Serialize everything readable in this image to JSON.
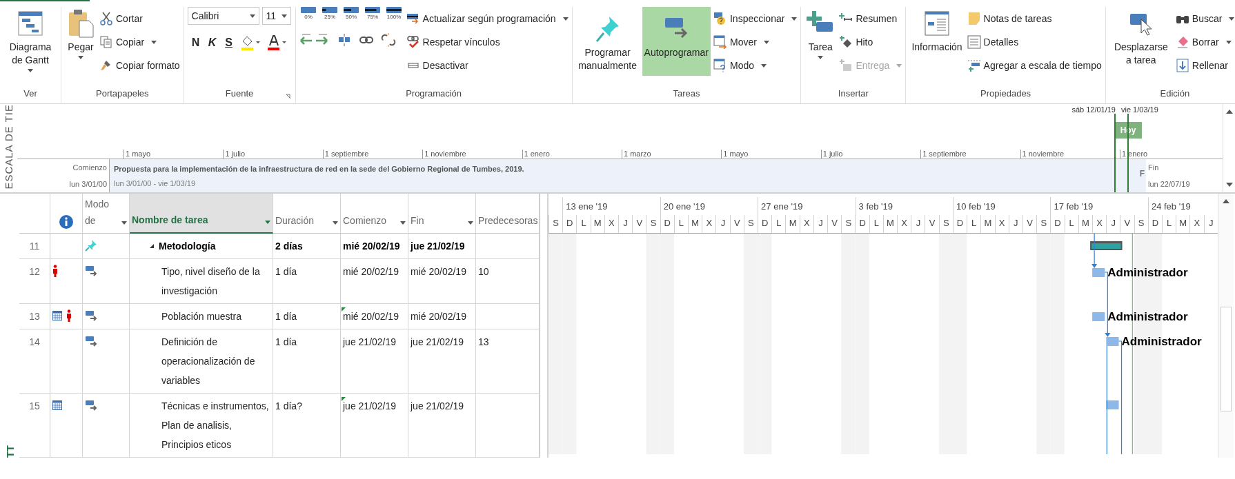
{
  "ribbon": {
    "view": {
      "label": "Ver",
      "gantt_chart": "Diagrama de Gantt"
    },
    "clipboard": {
      "label": "Portapapeles",
      "paste": "Pegar",
      "cut": "Cortar",
      "copy": "Copiar",
      "format_painter": "Copiar formato"
    },
    "font": {
      "label": "Fuente",
      "font_name": "Calibri",
      "font_size": "11",
      "bold": "N",
      "italic": "K",
      "underline": "S"
    },
    "schedule": {
      "label": "Programación",
      "percent_buttons": [
        "0%",
        "25%",
        "50%",
        "75%",
        "100%"
      ],
      "update_as_scheduled": "Actualizar según programación",
      "respect_links": "Respetar vínculos",
      "inactivate": "Desactivar"
    },
    "tasks": {
      "label": "Tareas",
      "manually_schedule": {
        "label": "Programar manualmente",
        "selected": false
      },
      "auto_schedule": {
        "label": "Autoprogramar",
        "selected": true
      },
      "inspect": "Inspeccionar",
      "move": "Mover",
      "mode": "Modo"
    },
    "insert": {
      "label": "Insertar",
      "task": "Tarea",
      "summary": "Resumen",
      "milestone": "Hito",
      "deliverable": {
        "label": "Entrega",
        "disabled": true
      }
    },
    "properties": {
      "label": "Propiedades",
      "information": "Información",
      "task_notes": "Notas de tareas",
      "details": "Detalles",
      "add_to_timeline": "Agregar a escala de tiempo"
    },
    "editing": {
      "label": "Edición",
      "scroll_to_task": "Desplazarse a tarea",
      "find": "Buscar",
      "clear": "Borrar",
      "fill": "Rellenar"
    }
  },
  "timeline": {
    "side_label": "ESCALA DE TIE",
    "view_start": "sáb 12/01/19",
    "view_end": "vie 1/03/19",
    "today": "Hoy",
    "months": [
      "1 mayo",
      "1 julio",
      "1 septiembre",
      "1 noviembre",
      "1 enero",
      "1 marzo",
      "1 mayo",
      "1 julio",
      "1 septiembre",
      "1 noviembre",
      "1 enero"
    ],
    "start_label": "Comienzo",
    "start_date": "lun 3/01/00",
    "finish_label": "Fin",
    "finish_date": "lun 22/07/19",
    "bar": {
      "title": "Propuesta para la implementación de la infraestructura de red en la sede del Gobierno Regional de Tumbes, 2019.",
      "dates": "lun 3/01/00 - vie 1/03/19",
      "end_text": "F"
    }
  },
  "sheet": {
    "side_label": "TT",
    "columns": [
      {
        "label": "Modo de",
        "filter": true,
        "selected": false
      },
      {
        "label": "Nombre de tarea",
        "filter": true,
        "selected": true
      },
      {
        "label": "Duración",
        "filter": true,
        "selected": false
      },
      {
        "label": "Comienzo",
        "filter": true,
        "selected": false
      },
      {
        "label": "Fin",
        "filter": true,
        "selected": false
      },
      {
        "label": "Predecesoras",
        "filter": false,
        "selected": false
      }
    ],
    "rows": [
      {
        "id": "11",
        "manually_scheduled": true,
        "calendar": false,
        "overallocated": false,
        "start_warning": false,
        "name": "Metodología",
        "expanded": true,
        "duration": "2 días",
        "start": "mié 20/02/19",
        "finish": "jue 21/02/19",
        "children": [
          {
            "id": "12",
            "manually_scheduled": false,
            "calendar": false,
            "overallocated": true,
            "start_warning": false,
            "name": "Tipo, nivel diseño de la investigación",
            "duration": "1 día",
            "start": "mié 20/02/19",
            "finish": "mié 20/02/19",
            "predecessors": "10",
            "resource": "Administrador"
          },
          {
            "id": "13",
            "manually_scheduled": false,
            "calendar": true,
            "overallocated": true,
            "start_warning": true,
            "name": "Población muestra",
            "duration": "1 día",
            "start": "mié 20/02/19",
            "finish": "mié 20/02/19",
            "resource": "Administrador"
          },
          {
            "id": "14",
            "manually_scheduled": false,
            "calendar": false,
            "overallocated": false,
            "start_warning": false,
            "name": "Definición de operacionalización de variables",
            "duration": "1 día",
            "start": "jue 21/02/19",
            "finish": "jue 21/02/19",
            "predecessors": "13",
            "resource": "Administrador"
          },
          {
            "id": "15",
            "manually_scheduled": false,
            "calendar": true,
            "overallocated": false,
            "start_warning": true,
            "name": "Técnicas e instrumentos, Plan de analisis, Principios eticos",
            "duration": "1 día?",
            "start": "jue 21/02/19",
            "finish": "jue 21/02/19"
          }
        ]
      }
    ]
  },
  "gantt": {
    "lead_days": [
      "S"
    ],
    "weeks": [
      {
        "label": "13 ene '19",
        "days": [
          "D",
          "L",
          "M",
          "X",
          "J",
          "V",
          "S"
        ]
      },
      {
        "label": "20 ene '19",
        "days": [
          "D",
          "L",
          "M",
          "X",
          "J",
          "V",
          "S"
        ]
      },
      {
        "label": "27 ene '19",
        "days": [
          "D",
          "L",
          "M",
          "X",
          "J",
          "V",
          "S"
        ]
      },
      {
        "label": "3 feb '19",
        "days": [
          "D",
          "L",
          "M",
          "X",
          "J",
          "V",
          "S"
        ]
      },
      {
        "label": "10 feb '19",
        "days": [
          "D",
          "L",
          "M",
          "X",
          "J",
          "V",
          "S"
        ]
      },
      {
        "label": "17 feb '19",
        "days": [
          "D",
          "L",
          "M",
          "X",
          "J",
          "V",
          "S"
        ]
      },
      {
        "label": "24 feb '19",
        "days": [
          "D",
          "L",
          "M",
          "X",
          "J"
        ]
      }
    ]
  }
}
